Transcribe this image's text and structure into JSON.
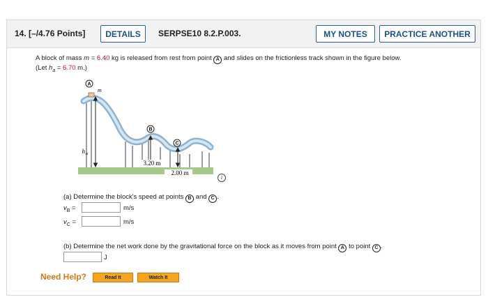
{
  "question": {
    "number": "14.",
    "points": "[–/4.76 Points]",
    "details_label": "DETAILS",
    "code": "SERPSE10 8.2.P.003.",
    "my_notes_label": "MY NOTES",
    "practice_label": "PRACTICE ANOTHER"
  },
  "problem": {
    "line1_a": "A block of mass ",
    "line1_var": "m",
    "line1_eq": " = ",
    "mass": "6.40",
    "line1_b": " kg is released from rest from point ",
    "pointA": "A",
    "line1_c": " and slides on the frictionless track shown in the figure below.",
    "line2_a": "(Let ",
    "line2_var": "h",
    "line2_sub": "a",
    "line2_eq": " = ",
    "ha_value": "6.70",
    "line2_b": " m.)"
  },
  "figure": {
    "label_A": "A",
    "label_B": "B",
    "label_C": "C",
    "label_m": "m",
    "label_ha": "h",
    "label_ha_sub": "a",
    "dim1": "3.20 m",
    "dim2": "2.00 m",
    "info": "i"
  },
  "part_a": {
    "prompt_a": "(a) Determine the block's speed at points ",
    "pointB": "B",
    "and": " and ",
    "pointC": "C",
    "end": ".",
    "vB_var": "v",
    "vB_sub": "B",
    "vC_var": "v",
    "vC_sub": "C",
    "eq": " =",
    "unit": "m/s",
    "vB_value": "",
    "vC_value": ""
  },
  "part_b": {
    "prompt_a": "(b) Determine the net work done by the gravitational force on the block as it moves from point ",
    "pointA": "A",
    "to": " to point ",
    "pointC": "C",
    "end": ".",
    "unit": "J",
    "value": ""
  },
  "help": {
    "label": "Need Help?",
    "read_it": "Read It",
    "watch_it": "Watch It"
  }
}
